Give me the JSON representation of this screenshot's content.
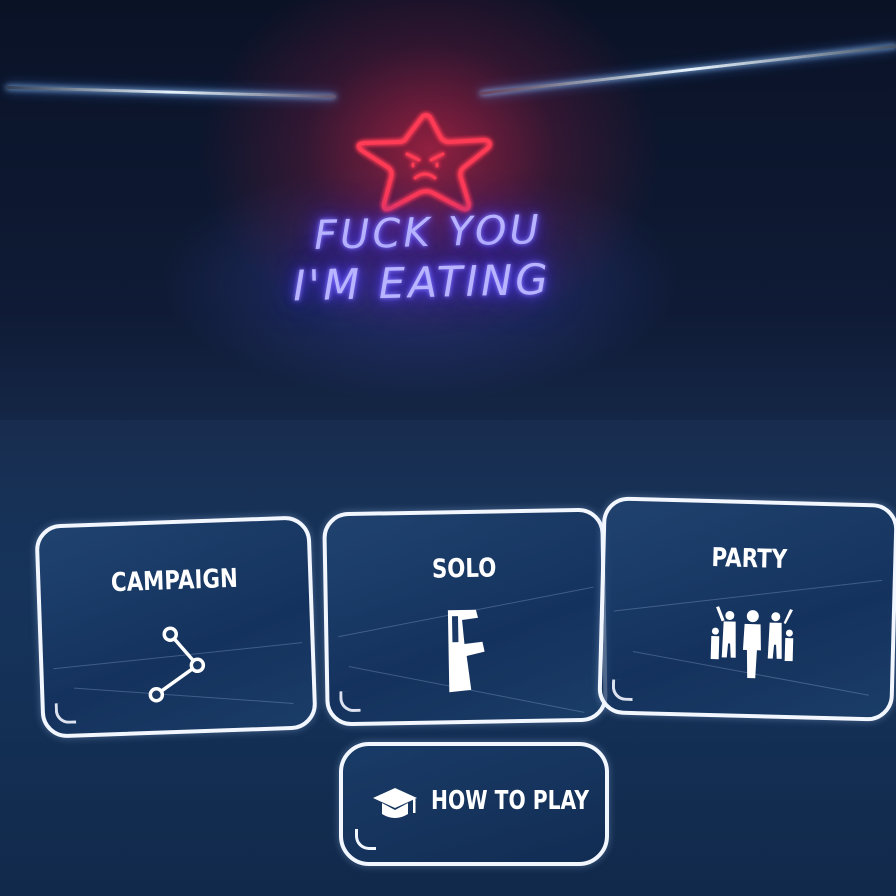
{
  "sign": {
    "line1": "FUCK YOU",
    "line2": "I'M EATING",
    "star_icon": "angry-star-icon",
    "star_color": "#ff2a45",
    "text_color": "#6f5dff"
  },
  "menu": {
    "cards": [
      {
        "label": "CAMPAIGN",
        "icon": "campaign-path-icon"
      },
      {
        "label": "SOLO",
        "icon": "arcade-cabinet-icon"
      },
      {
        "label": "PARTY",
        "icon": "party-crowd-icon"
      }
    ],
    "how_to_play": {
      "label": "HOW TO PLAY",
      "icon": "graduation-cap-icon"
    }
  },
  "colors": {
    "accent_white": "#f2f6ff",
    "panel_blue": "#14335c",
    "laser": "#e8f4ff"
  }
}
